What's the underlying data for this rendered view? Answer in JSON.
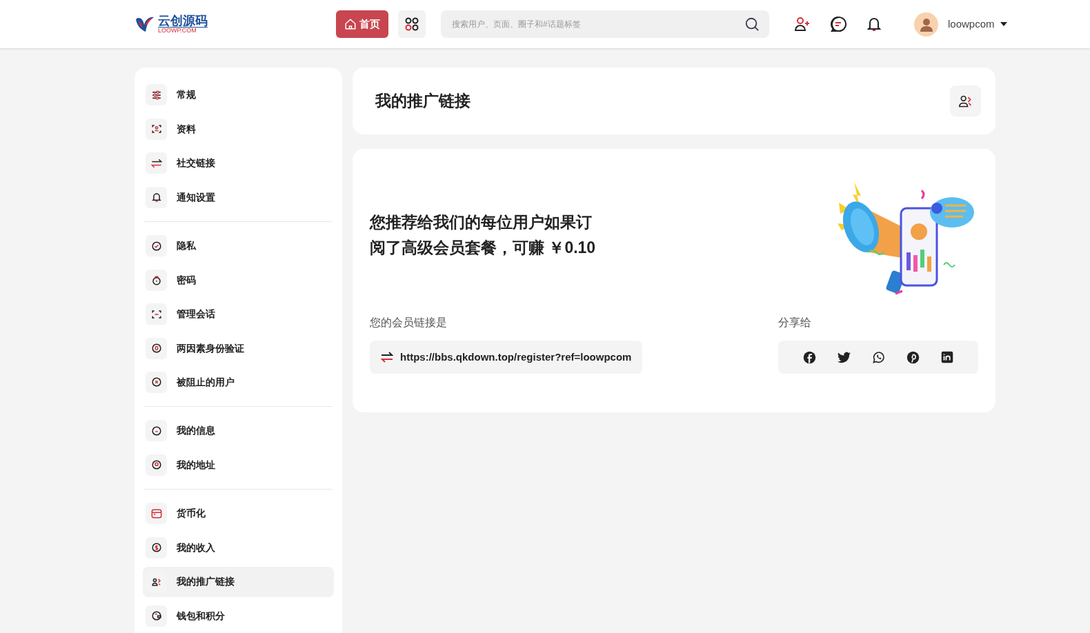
{
  "header": {
    "logo": {
      "name": "云创源码",
      "domain": "LOOWP.COM"
    },
    "home_button": "首页",
    "search": {
      "placeholder": "搜索用户、页面、圈子和#话题标签"
    },
    "user": {
      "name": "loowpcom"
    }
  },
  "sidebar": {
    "groups": [
      [
        {
          "label": "常规",
          "selected": false
        },
        {
          "label": "资料",
          "selected": false
        },
        {
          "label": "社交链接",
          "selected": false
        },
        {
          "label": "通知设置",
          "selected": false
        }
      ],
      [
        {
          "label": "隐私",
          "selected": false
        },
        {
          "label": "密码",
          "selected": false
        },
        {
          "label": "管理会话",
          "selected": false
        },
        {
          "label": "两因素身份验证",
          "selected": false
        },
        {
          "label": "被阻止的用户",
          "selected": false
        }
      ],
      [
        {
          "label": "我的信息",
          "selected": false
        },
        {
          "label": "我的地址",
          "selected": false
        }
      ],
      [
        {
          "label": "货币化",
          "selected": false
        },
        {
          "label": "我的收入",
          "selected": false
        },
        {
          "label": "我的推广链接",
          "selected": true
        },
        {
          "label": "钱包和积分",
          "selected": false
        }
      ]
    ]
  },
  "page_title": "我的推广链接",
  "promo": {
    "headline": "您推荐给我们的每位用户如果订阅了高级会员套餐，可赚 ￥0.10",
    "link_label": "您的会员链接是",
    "link": "https://bbs.qkdown.top/register?ref=loowpcom",
    "share_label": "分享给"
  }
}
